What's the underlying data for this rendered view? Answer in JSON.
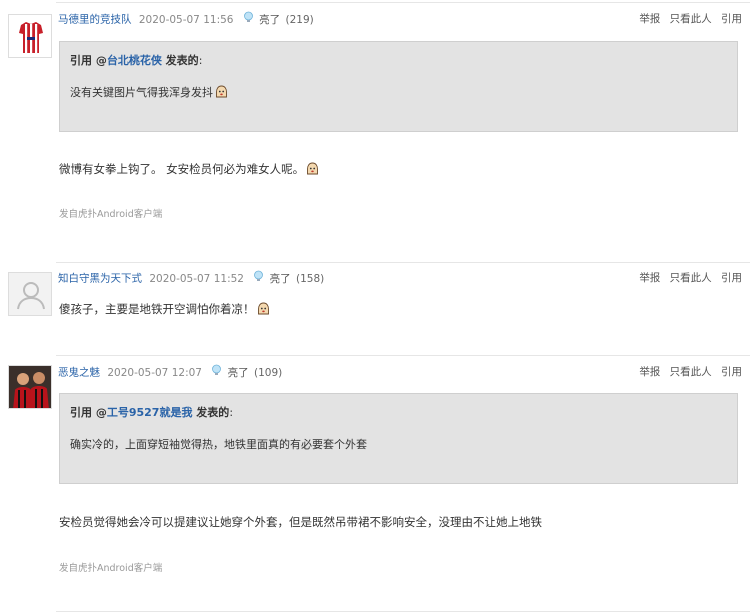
{
  "posts": [
    {
      "user": "马德里的竞技队",
      "time": "2020-05-07 11:56",
      "light_label": "亮了",
      "light_count": "(219)",
      "actions": [
        "举报",
        "只看此人",
        "引用"
      ],
      "quote": {
        "prefix": "引用 @",
        "quoted_user": "台北桃花侠",
        "suffix": " 发表的",
        "colon": ":",
        "text": "没有关键图片气得我浑身发抖"
      },
      "text": "微博有女拳上钩了。 女安检员何必为难女人呢。",
      "from": "发自虎扑Android客户端"
    },
    {
      "user": "知白守黑为天下式",
      "time": "2020-05-07 11:52",
      "light_label": "亮了",
      "light_count": "(158)",
      "actions": [
        "举报",
        "只看此人",
        "引用"
      ],
      "text": "傻孩子，主要是地铁开空调怕你着凉！"
    },
    {
      "user": "恶鬼之魅",
      "time": "2020-05-07 12:07",
      "light_label": "亮了",
      "light_count": "(109)",
      "actions": [
        "举报",
        "只看此人",
        "引用"
      ],
      "quote": {
        "prefix": "引用 @",
        "quoted_user": "工号9527就是我",
        "suffix": " 发表的",
        "colon": ":",
        "text": "确实冷的，上面穿短袖觉得热，地铁里面真的有必要套个外套"
      },
      "text": "安检员觉得她会冷可以提建议让她穿个外套，但是既然吊带裙不影响安全，没理由不让她上地铁",
      "from": "发自虎扑Android客户端"
    }
  ]
}
